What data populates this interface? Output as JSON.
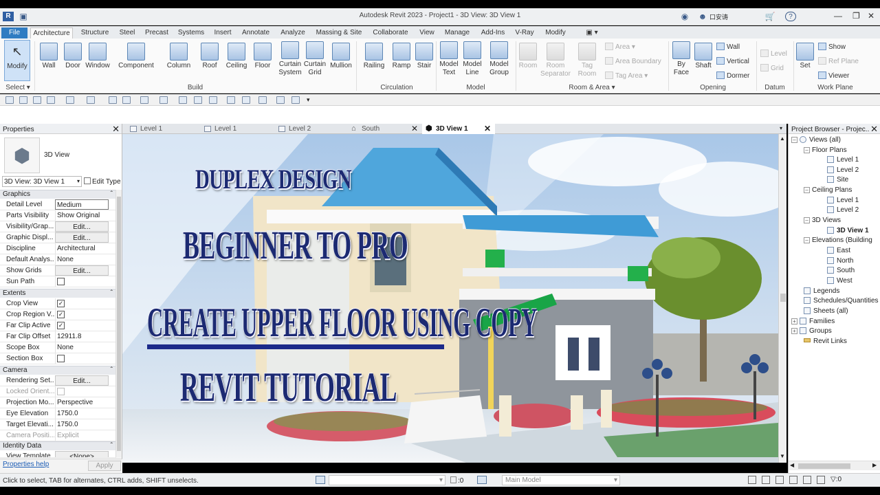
{
  "app": {
    "title": "Autodesk Revit 2023 - Project1 - 3D View: 3D View 1",
    "user": "口安诪",
    "help": "?"
  },
  "ribbon": {
    "tabs": [
      "File",
      "Architecture",
      "Structure",
      "Steel",
      "Precast",
      "Systems",
      "Insert",
      "Annotate",
      "Analyze",
      "Massing & Site",
      "Collaborate",
      "View",
      "Manage",
      "Add-Ins",
      "V-Ray",
      "Modify"
    ],
    "select": {
      "modify": "Modify",
      "panel": "Select ▾"
    },
    "build": {
      "label": "Build",
      "wall": "Wall",
      "door": "Door",
      "window": "Window",
      "component": "Component",
      "column": "Column",
      "roof": "Roof",
      "ceiling": "Ceiling",
      "floor": "Floor",
      "curtain_system": "Curtain\nSystem",
      "curtain_grid": "Curtain\nGrid",
      "mullion": "Mullion"
    },
    "circulation": {
      "label": "Circulation",
      "railing": "Railing",
      "ramp": "Ramp",
      "stair": "Stair"
    },
    "model": {
      "label": "Model",
      "model_text": "Model\nText",
      "model_line": "Model\nLine",
      "model_group": "Model\nGroup"
    },
    "room_area": {
      "label": "Room & Area ▾",
      "room": "Room",
      "room_separator": "Room\nSeparator",
      "tag_room": "Tag\nRoom",
      "area": "Area",
      "area_boundary": "Area Boundary",
      "tag_area": "Tag Area"
    },
    "opening": {
      "label": "Opening",
      "by_face": "By\nFace",
      "shaft": "Shaft",
      "wall": "Wall",
      "vertical": "Vertical",
      "dormer": "Dormer"
    },
    "datum": {
      "label": "Datum",
      "level": "Level",
      "grid": "Grid"
    },
    "work_plane": {
      "label": "Work Plane",
      "set": "Set",
      "show": "Show",
      "ref_plane": "Ref Plane",
      "viewer": "Viewer"
    }
  },
  "properties": {
    "title": "Properties",
    "type_name": "3D View",
    "instance_selector": "3D View: 3D View 1",
    "edit_type": "Edit Type",
    "sections": {
      "graphics": "Graphics",
      "extents": "Extents",
      "camera": "Camera",
      "identity": "Identity Data"
    },
    "rows": {
      "detail_level": {
        "name": "Detail Level",
        "value": "Medium"
      },
      "parts_visibility": {
        "name": "Parts Visibility",
        "value": "Show Original"
      },
      "visibility_graphics": {
        "name": "Visibility/Grap...",
        "value": "Edit..."
      },
      "graphic_display": {
        "name": "Graphic Displ...",
        "value": "Edit..."
      },
      "discipline": {
        "name": "Discipline",
        "value": "Architectural"
      },
      "default_analysis": {
        "name": "Default Analys...",
        "value": "None"
      },
      "show_grids": {
        "name": "Show Grids",
        "value": "Edit..."
      },
      "sun_path": {
        "name": "Sun Path",
        "value": ""
      },
      "crop_view": {
        "name": "Crop View",
        "value": "✓"
      },
      "crop_region": {
        "name": "Crop Region V...",
        "value": "✓"
      },
      "far_clip_active": {
        "name": "Far Clip Active",
        "value": "✓"
      },
      "far_clip_offset": {
        "name": "Far Clip Offset",
        "value": "12911.8"
      },
      "scope_box": {
        "name": "Scope Box",
        "value": "None"
      },
      "section_box": {
        "name": "Section Box",
        "value": ""
      },
      "rendering_settings": {
        "name": "Rendering Set...",
        "value": "Edit..."
      },
      "locked_orientation": {
        "name": "Locked Orient...",
        "value": ""
      },
      "projection_mode": {
        "name": "Projection Mo...",
        "value": "Perspective"
      },
      "eye_elevation": {
        "name": "Eye Elevation",
        "value": "1750.0"
      },
      "target_elevation": {
        "name": "Target Elevati...",
        "value": "1750.0"
      },
      "camera_position": {
        "name": "Camera Positi...",
        "value": "Explicit"
      },
      "view_template": {
        "name": "View Template",
        "value": "<None>"
      }
    },
    "help_link": "Properties help",
    "apply": "Apply"
  },
  "view_tabs": [
    {
      "label": "Level 1"
    },
    {
      "label": "Level 1"
    },
    {
      "label": "Level 2"
    },
    {
      "label": "South"
    },
    {
      "label": "3D View 1"
    }
  ],
  "canvas_text": {
    "line1": "DUPLEX DESIGN",
    "line2": "BEGINNER TO PRO",
    "line3": "CREATE UPPER FLOOR USING COPY",
    "line4": "REVIT  TUTORIAL"
  },
  "project_browser": {
    "title": "Project Browser - Projec...",
    "views_all": "Views (all)",
    "floor_plans": "Floor Plans",
    "fp_level1": "Level 1",
    "fp_level2": "Level 2",
    "fp_site": "Site",
    "ceiling_plans": "Ceiling Plans",
    "cp_level1": "Level 1",
    "cp_level2": "Level 2",
    "views_3d": "3D Views",
    "view_3d1": "3D View 1",
    "elevations": "Elevations (Building",
    "el_east": "East",
    "el_north": "North",
    "el_south": "South",
    "el_west": "West",
    "legends": "Legends",
    "schedules": "Schedules/Quantities",
    "sheets": "Sheets (all)",
    "families": "Families",
    "groups": "Groups",
    "revit_links": "Revit Links"
  },
  "status": {
    "hint": "Click to select, TAB for alternates, CTRL adds, SHIFT unselects.",
    "workset_count": ":0",
    "design_option": "Main Model",
    "filter_count": ":0"
  },
  "colors": {
    "file_tab": "#2f7cc2",
    "headline": "#1c2a72"
  }
}
